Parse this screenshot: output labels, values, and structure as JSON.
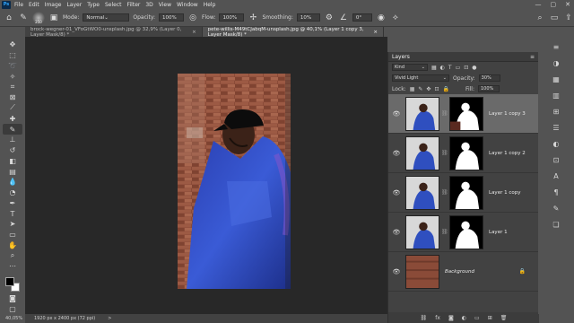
{
  "menubar": {
    "logo": "Ps",
    "items": [
      "File",
      "Edit",
      "Image",
      "Layer",
      "Type",
      "Select",
      "Filter",
      "3D",
      "View",
      "Window",
      "Help"
    ],
    "win_min": "—",
    "win_max": "▢",
    "win_close": "✕"
  },
  "options": {
    "brush_size": "250",
    "mode_label": "Mode:",
    "mode_value": "Normal",
    "opacity_label": "Opacity:",
    "opacity_value": "100%",
    "flow_label": "Flow:",
    "flow_value": "100%",
    "smoothing_label": "Smoothing:",
    "smoothing_value": "10%",
    "angle_value": "0°"
  },
  "tabs": [
    {
      "label": "brock-wegner-01_VFoGtWO0-unsplash.jpg @ 32,9% (Layer 0, Layer Mask/8) *",
      "close": "×"
    },
    {
      "label": "pete-willis-M49tCJabqM-unsplash.jpg @ 40,1% (Layer 1 copy 3, Layer Mask/8) *",
      "close": "×"
    }
  ],
  "status": {
    "zoom": "40,05%",
    "doc_size": "1920 px x 2400 px (72 ppi)",
    "arrow": ">"
  },
  "layers_panel": {
    "title": "Layers",
    "filter_kind": "Kind",
    "blend_mode": "Vivid Light",
    "opacity_label": "Opacity:",
    "opacity_value": "30%",
    "lock_label": "Lock:",
    "fill_label": "Fill:",
    "fill_value": "100%",
    "layers": [
      {
        "name": "Layer 1 copy 3",
        "selected": true
      },
      {
        "name": "Layer 1 copy 2",
        "selected": false
      },
      {
        "name": "Layer 1 copy",
        "selected": false
      },
      {
        "name": "Layer 1",
        "selected": false
      },
      {
        "name": "Background",
        "selected": false
      }
    ],
    "footer_icons": [
      "link",
      "fx",
      "mask",
      "adjust",
      "group",
      "new",
      "trash"
    ]
  },
  "colors": {
    "ui_dark": "#535353",
    "canvas_bg": "#282828",
    "panel_bg": "#424242",
    "selected_row": "#6a6a6a",
    "hoodie_blue": "#2f4fbf",
    "brick": "#8a4b38"
  }
}
